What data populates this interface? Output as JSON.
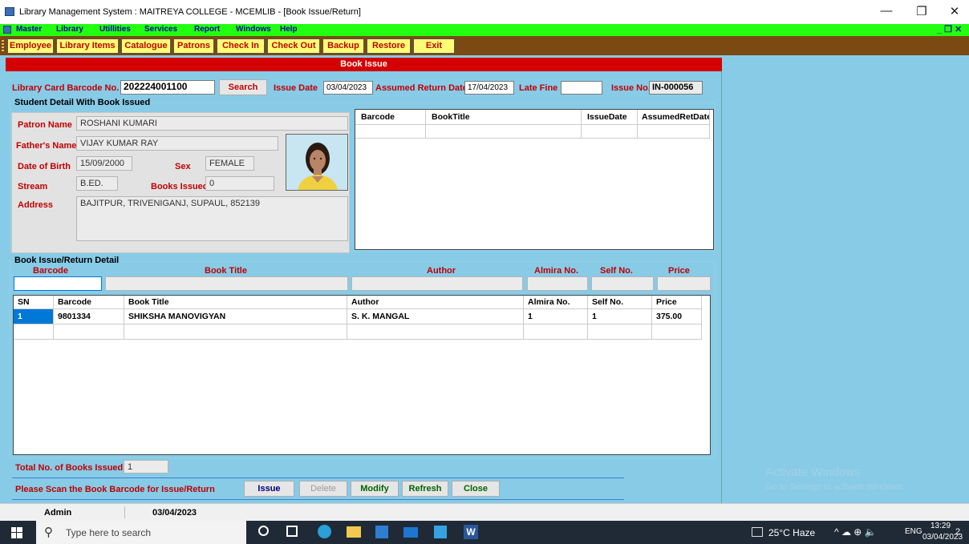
{
  "window": {
    "title": "Library Management System : MAITREYA COLLEGE - MCEMLIB - [Book Issue/Return]",
    "minimize_glyph": "—",
    "maximize_glyph": "❐",
    "close_glyph": "✕"
  },
  "menu": {
    "items": [
      "Master",
      "Library",
      "Utillities",
      "Services",
      "Report",
      "Windows",
      "Help"
    ],
    "mdi_controls": "_ ❐ ✕"
  },
  "toolbar": {
    "buttons": [
      "Employee",
      "Library Items",
      "Catalogue",
      "Patrons",
      "Check In",
      "Check Out",
      "Backup",
      "Restore",
      "Exit"
    ]
  },
  "form": {
    "header": "Book Issue",
    "card_label": "Library Card Barcode No.",
    "card_value": "202224001100",
    "search_button": "Search",
    "issue_date_label": "Issue Date",
    "issue_date_value": "03/04/2023",
    "return_date_label": "Assumed Return Date",
    "return_date_value": "17/04/2023",
    "late_fine_label": "Late Fine",
    "late_fine_value": "",
    "issue_no_label": "Issue No.",
    "issue_no_value": "IN-000056"
  },
  "student": {
    "section_title": "Student Detail With Book Issued",
    "patron_name_label": "Patron Name",
    "patron_name": "ROSHANI KUMARI",
    "father_label": "Father's Name",
    "father_name": "VIJAY KUMAR RAY",
    "dob_label": "Date of Birth",
    "dob": "15/09/2000",
    "sex_label": "Sex",
    "sex": "FEMALE",
    "stream_label": "Stream",
    "stream": "B.ED.",
    "books_issued_label": "Books Issued",
    "books_issued": "0",
    "address_label": "Address",
    "address": "BAJITPUR, TRIVENIGANJ, SUPAUL, 852139"
  },
  "issued_grid": {
    "columns": [
      "Barcode",
      "BookTitle",
      "IssueDate",
      "AssumedRetDate"
    ],
    "rows": []
  },
  "entry": {
    "section_title": "Book Issue/Return Detail",
    "labels": [
      "Barcode",
      "Book Title",
      "Author",
      "Almira No.",
      "Self No.",
      "Price"
    ],
    "values": [
      "",
      "",
      "",
      "",
      "",
      ""
    ]
  },
  "books_grid": {
    "columns": [
      "SN",
      "Barcode",
      "Book Title",
      "Author",
      "Almira No.",
      "Self No.",
      "Price"
    ],
    "rows": [
      [
        "1",
        "9801334",
        "SHIKSHA MANOVIGYAN",
        "S. K. MANGAL",
        "1",
        "1",
        "375.00"
      ]
    ]
  },
  "footer": {
    "total_label": "Total No. of Books Issued",
    "total_value": "1",
    "scan_message": "Please Scan the Book Barcode for Issue/Return",
    "buttons": {
      "issue": "Issue",
      "delete": "Delete",
      "modify": "Modify",
      "refresh": "Refresh",
      "close": "Close"
    }
  },
  "statusbar": {
    "user": "Admin",
    "date": "03/04/2023"
  },
  "watermark": {
    "line1": "Activate Windows",
    "line2": "Go to Settings to activate Windows."
  },
  "taskbar": {
    "search_placeholder": "Type here to search",
    "weather": "25°C  Haze",
    "language": "ENG",
    "time": "13:29",
    "date": "03/04/2023",
    "notification_count": "2"
  },
  "colors": {
    "menubar": "#22ff10",
    "toolbar": "#7b4a12",
    "toolbar_button": "#ffff75",
    "form_header": "#d40000",
    "label_red": "#c00000",
    "workspace": "#87cbe7",
    "selection": "#0078d7"
  }
}
